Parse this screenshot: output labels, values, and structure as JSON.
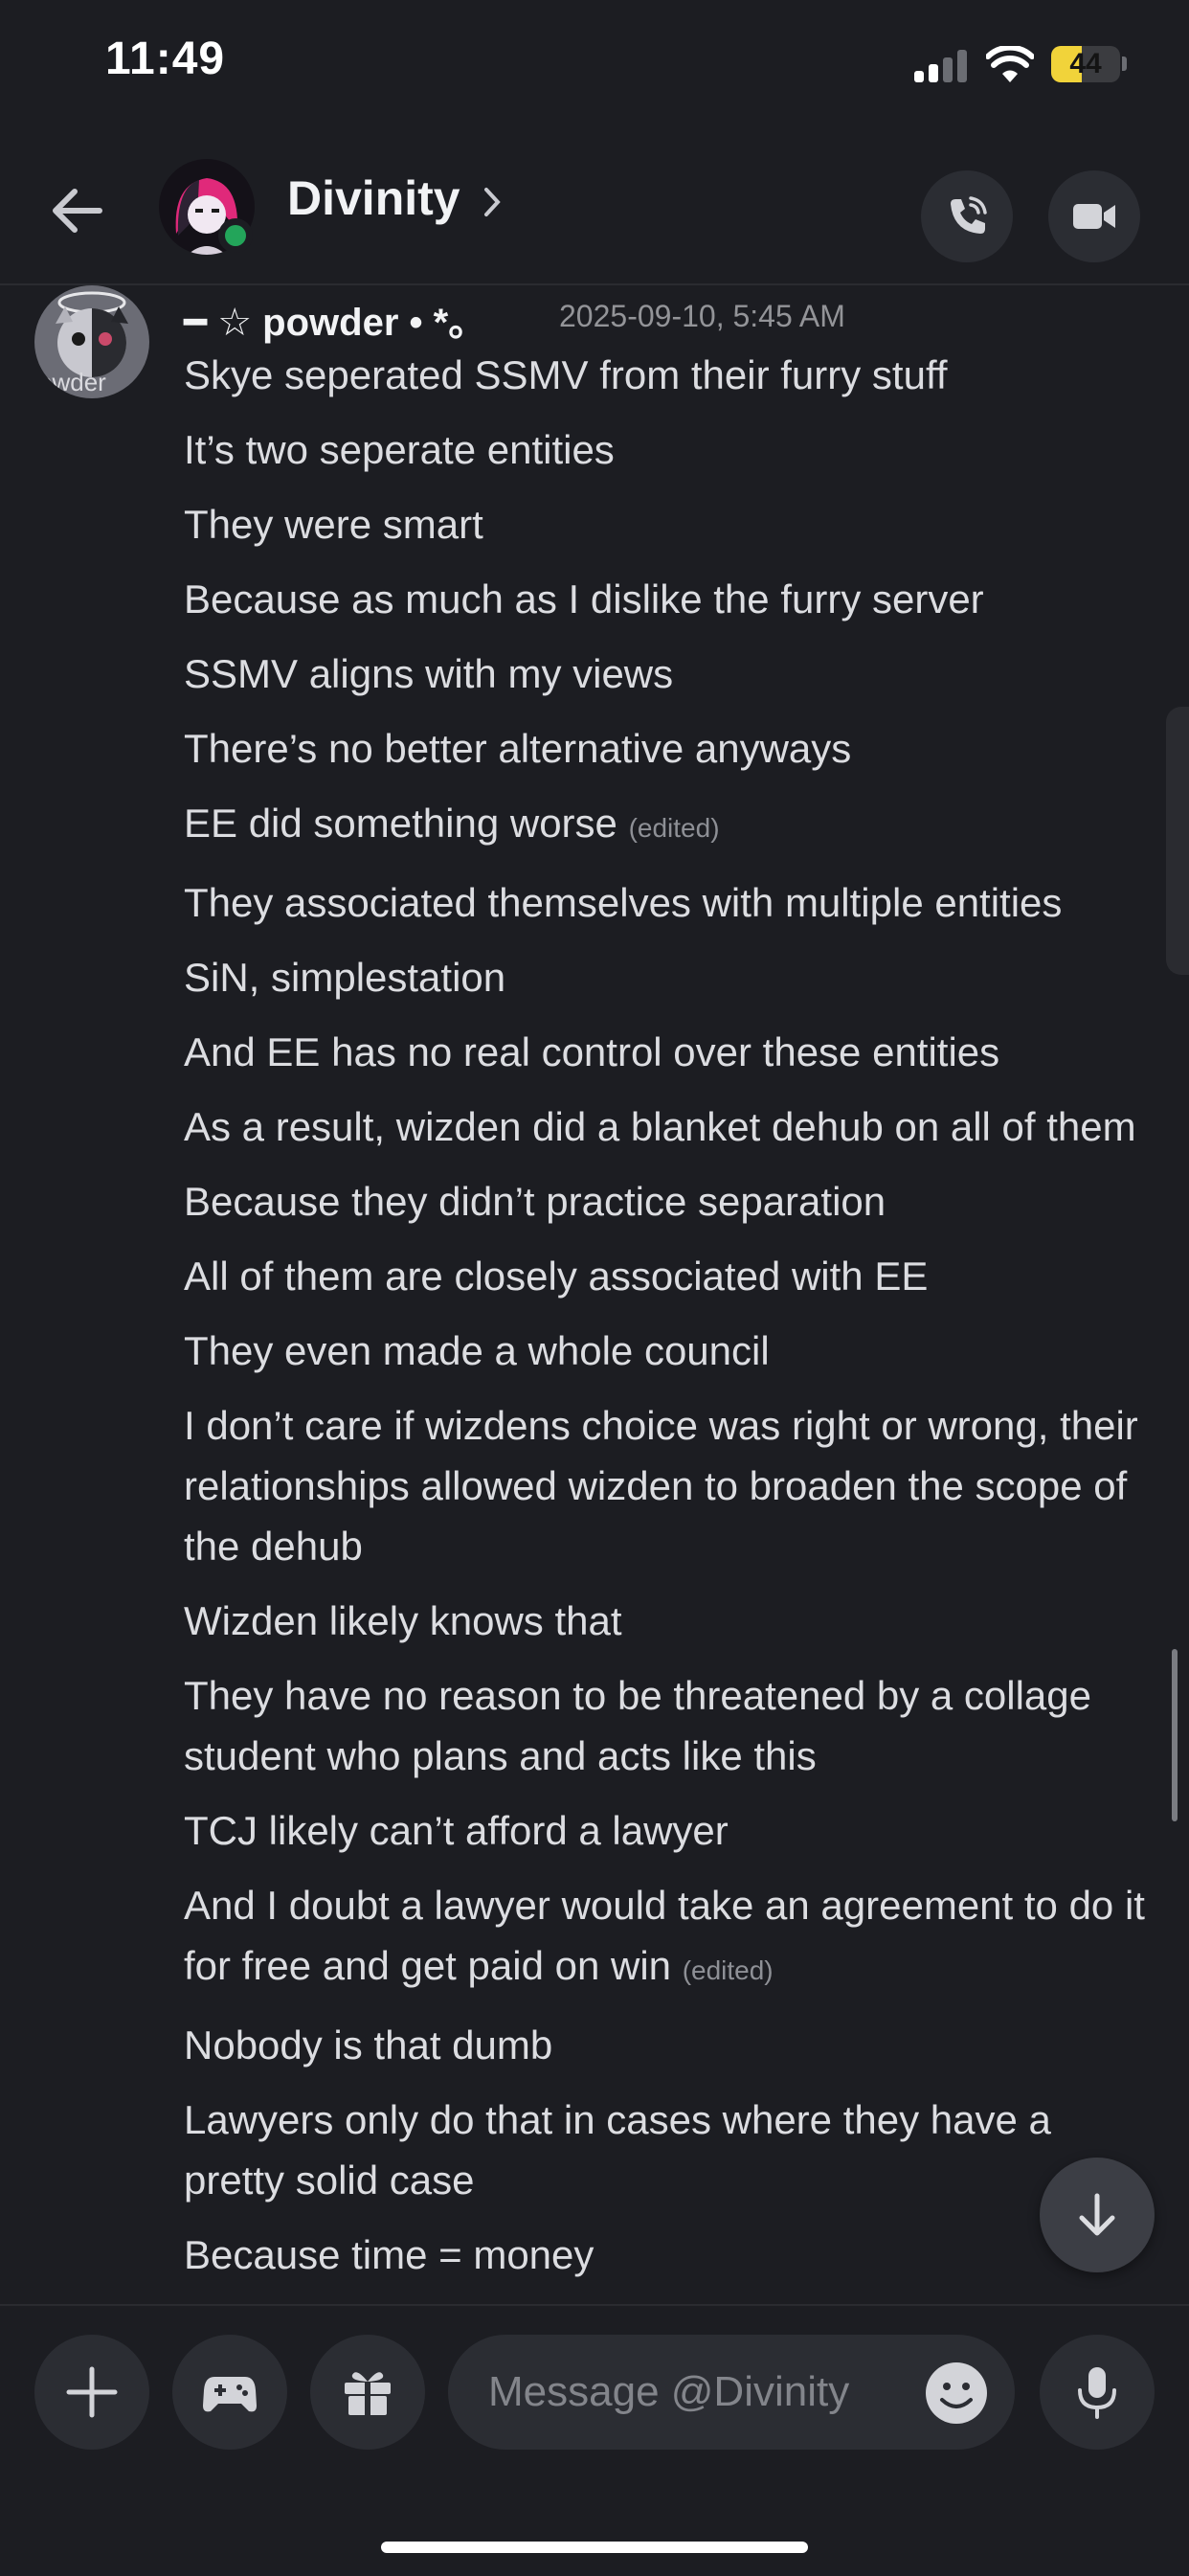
{
  "status_bar": {
    "time": "11:49",
    "battery": "44",
    "battery_level": 0.44
  },
  "header": {
    "channel_name": "Divinity"
  },
  "message": {
    "author": "━ ☆ powder • *。",
    "avatar_text": "owder",
    "timestamp": "2025-09-10, 5:45 AM",
    "lines": [
      {
        "text": "Skye seperated SSMV from their furry stuff",
        "edited": ""
      },
      {
        "text": "It’s two seperate entities",
        "edited": ""
      },
      {
        "text": "They were smart",
        "edited": ""
      },
      {
        "text": "Because as much as I dislike the furry server",
        "edited": ""
      },
      {
        "text": "SSMV aligns with my views",
        "edited": ""
      },
      {
        "text": "There’s no better alternative anyways",
        "edited": ""
      },
      {
        "text": "EE did something worse",
        "edited": "(edited)"
      },
      {
        "text": "They associated themselves with multiple entities",
        "edited": ""
      },
      {
        "text": "SiN, simplestation",
        "edited": ""
      },
      {
        "text": "And EE has no real control over these entities",
        "edited": ""
      },
      {
        "text": "As a result, wizden did a blanket dehub on all of them",
        "edited": ""
      },
      {
        "text": "Because they didn’t practice separation",
        "edited": ""
      },
      {
        "text": "All of them are closely associated with EE",
        "edited": ""
      },
      {
        "text": "They even made a whole council",
        "edited": ""
      },
      {
        "text": "I don’t care if wizdens choice was right or wrong, their relationships allowed wizden to broaden the scope of the dehub",
        "edited": ""
      },
      {
        "text": "Wizden likely knows that",
        "edited": ""
      },
      {
        "text": "They have no reason to be threatened by a collage student who plans and acts like this",
        "edited": ""
      },
      {
        "text": "TCJ likely can’t afford a lawyer",
        "edited": ""
      },
      {
        "text": "And I doubt a lawyer would take an agreement to do it for free and get paid on win",
        "edited": "(edited)"
      },
      {
        "text": "Nobody is that dumb",
        "edited": ""
      },
      {
        "text": "Lawyers only do that in cases where they have a pretty solid case",
        "edited": ""
      },
      {
        "text": "Because time = money",
        "edited": ""
      }
    ]
  },
  "composer": {
    "placeholder": "Message @Divinity"
  },
  "icons": {
    "back": "arrow-left-icon",
    "call": "phone-icon",
    "video": "video-camera-icon",
    "plus": "plus-icon",
    "games": "gamepad-icon",
    "gift": "gift-icon",
    "emoji": "emoji-icon",
    "mic": "microphone-icon",
    "jump": "arrow-down-icon"
  },
  "colors": {
    "background": "#1c1d22",
    "presence": "#23a55a",
    "battery": "#f1d33a",
    "avatar_accent": "#e0297a"
  }
}
